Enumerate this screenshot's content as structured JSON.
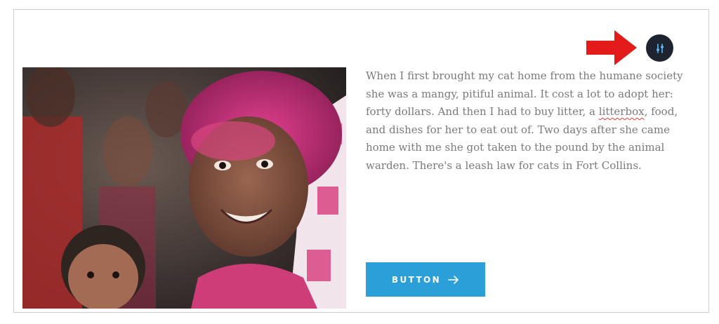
{
  "content": {
    "paragraph_part1": "When I first brought my cat home from the humane society she was a mangy, pitiful animal. It cost a lot to adopt her: forty dollars. And then I had to buy litter, a ",
    "paragraph_flagged_word": "litterbox",
    "paragraph_part2": ", food, and dishes for her to eat out of. Two days after she came home with me she got taken to the pound by the animal warden. There's a leash law for cats in Fort Collins."
  },
  "button": {
    "label": "BUTTON",
    "icon": "arrow-right-icon",
    "color": "#2a9fd8"
  },
  "settings": {
    "icon": "sliders-icon",
    "color": "#1d2430"
  },
  "annotation": {
    "icon": "red-arrow-icon",
    "color": "#e31b1b"
  }
}
